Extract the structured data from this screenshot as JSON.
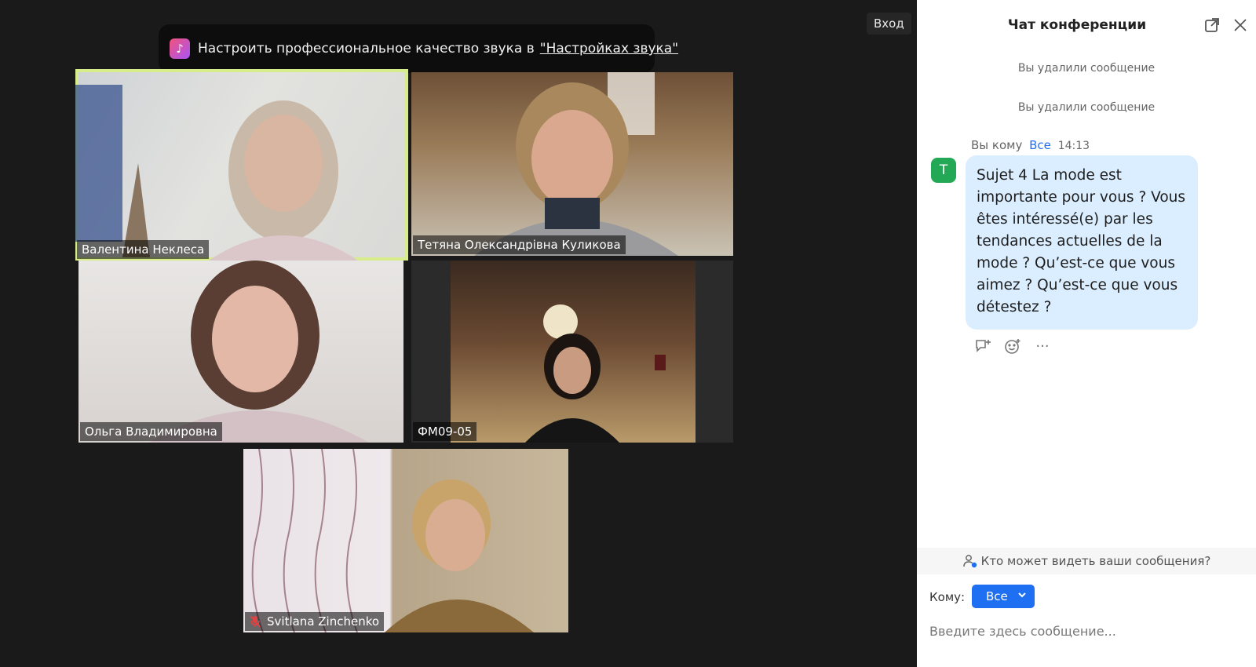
{
  "header": {
    "login_label": "Вход"
  },
  "notice": {
    "text": "Настроить профессиональное качество звука в",
    "link_text": "\"Настройках звука\""
  },
  "participants": [
    {
      "name": "Валентина Неклеса",
      "active_speaker": true,
      "muted": false
    },
    {
      "name": "Тетяна Олександрівна Куликова",
      "active_speaker": false,
      "muted": false
    },
    {
      "name": "Ольга Владимировна",
      "active_speaker": false,
      "muted": false
    },
    {
      "name": "ФМ09-05",
      "active_speaker": false,
      "muted": false
    },
    {
      "name": "Svitlana Zinchenko",
      "active_speaker": false,
      "muted": true
    }
  ],
  "chat": {
    "title": "Чат конференции",
    "deleted_messages": [
      "Вы удалили сообщение",
      "Вы удалили сообщение"
    ],
    "message": {
      "sender": "Вы кому",
      "recipient": "Все",
      "time": "14:13",
      "avatar_initial": "Т",
      "text": "Sujet 4 La mode est importante pour vous ? Vous êtes intéressé(e) par les tendances actuelles de la mode ? Qu’est-ce que vous aimez ? Qu’est-ce que vous détestez ?"
    },
    "who_can_see": "Кто может видеть ваши сообщения?",
    "to_label": "Кому:",
    "to_value": "Все",
    "input_placeholder": "Введите здесь сообщение..."
  },
  "colors": {
    "background": "#1a1a1a",
    "accent": "#1f6ff2",
    "active_speaker_border": "#d7ec8a",
    "bubble": "#dbeeff",
    "avatar": "#23a956"
  },
  "icons": {
    "notice": "music-note-icon",
    "popout": "popout-icon",
    "close": "close-icon",
    "reply": "reply-icon",
    "reaction": "emoji-add-icon",
    "more": "more-icon",
    "visibility": "person-info-icon",
    "dropdown": "chevron-down-icon",
    "mic": "mic-off-icon"
  }
}
